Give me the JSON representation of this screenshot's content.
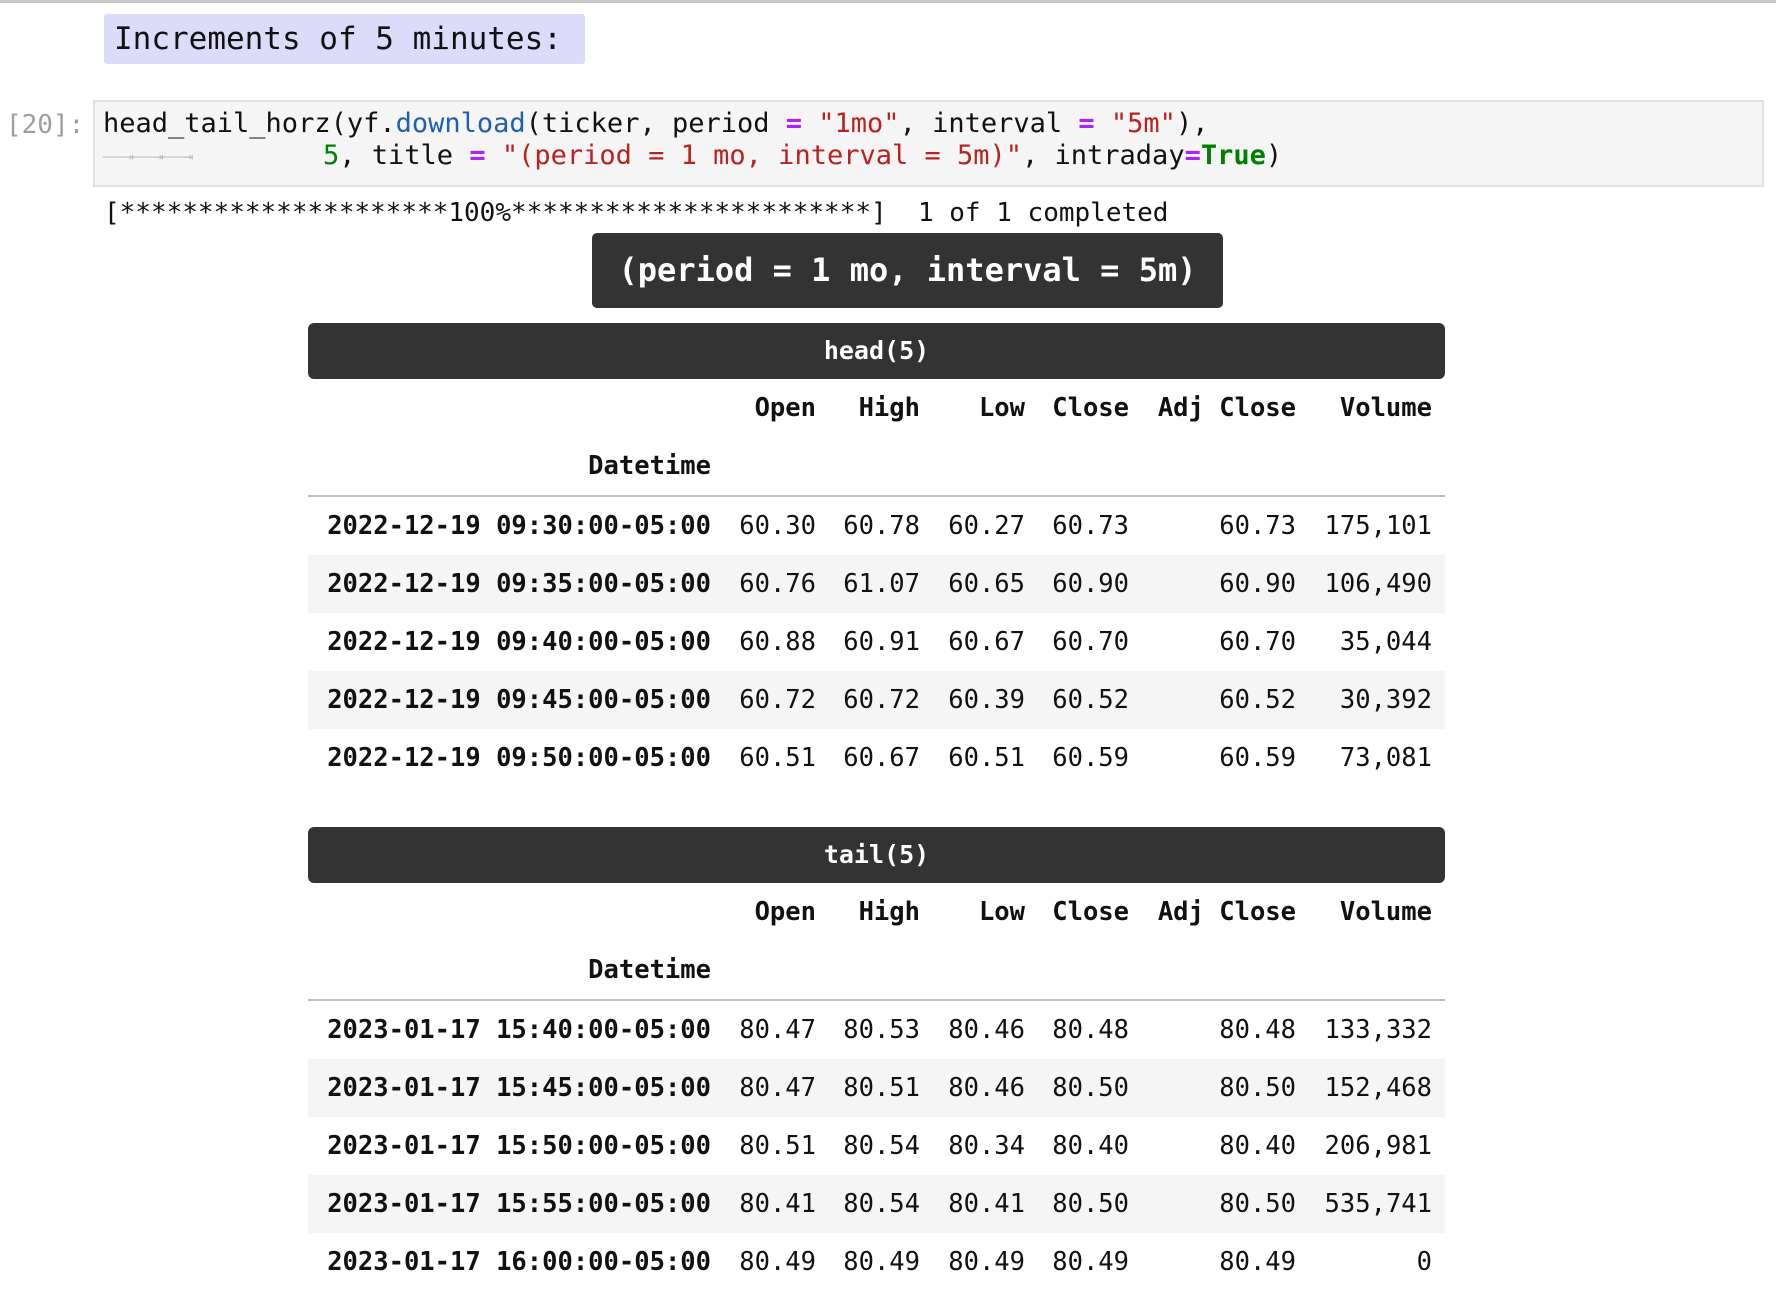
{
  "markdown_heading": "Increments of 5 minutes:",
  "prompt": "[20]:",
  "code": {
    "l1_a": "head_tail_horz(yf.",
    "l1_fn": "download",
    "l1_b": "(ticker, period ",
    "eq": "=",
    "l1_s1": "\"1mo\"",
    "l1_c": ", interval ",
    "l1_s2": "\"5m\"",
    "l1_d": "),",
    "tab_marks": "———⇥———⇥———⇥",
    "l2_num": "5",
    "l2_a": ", title ",
    "l2_s": "\"(period = 1 mo, interval = 5m)\"",
    "l2_b": ", intraday",
    "l2_kw": "True",
    "l2_c": ")"
  },
  "progress": "[*********************100%***********************]  1 of 1 completed",
  "title": "(period = 1 mo, interval = 5m)",
  "columns": [
    "Open",
    "High",
    "Low",
    "Close",
    "Adj Close",
    "Volume"
  ],
  "index_name": "Datetime",
  "head": {
    "label": "head(5)",
    "rows": [
      [
        "2022-12-19 09:30:00-05:00",
        "60.30",
        "60.78",
        "60.27",
        "60.73",
        "60.73",
        "175,101"
      ],
      [
        "2022-12-19 09:35:00-05:00",
        "60.76",
        "61.07",
        "60.65",
        "60.90",
        "60.90",
        "106,490"
      ],
      [
        "2022-12-19 09:40:00-05:00",
        "60.88",
        "60.91",
        "60.67",
        "60.70",
        "60.70",
        "35,044"
      ],
      [
        "2022-12-19 09:45:00-05:00",
        "60.72",
        "60.72",
        "60.39",
        "60.52",
        "60.52",
        "30,392"
      ],
      [
        "2022-12-19 09:50:00-05:00",
        "60.51",
        "60.67",
        "60.51",
        "60.59",
        "60.59",
        "73,081"
      ]
    ]
  },
  "tail": {
    "label": "tail(5)",
    "rows": [
      [
        "2023-01-17 15:40:00-05:00",
        "80.47",
        "80.53",
        "80.46",
        "80.48",
        "80.48",
        "133,332"
      ],
      [
        "2023-01-17 15:45:00-05:00",
        "80.47",
        "80.51",
        "80.46",
        "80.50",
        "80.50",
        "152,468"
      ],
      [
        "2023-01-17 15:50:00-05:00",
        "80.51",
        "80.54",
        "80.34",
        "80.40",
        "80.40",
        "206,981"
      ],
      [
        "2023-01-17 15:55:00-05:00",
        "80.41",
        "80.54",
        "80.41",
        "80.50",
        "80.50",
        "535,741"
      ],
      [
        "2023-01-17 16:00:00-05:00",
        "80.49",
        "80.49",
        "80.49",
        "80.49",
        "80.49",
        "0"
      ]
    ]
  }
}
